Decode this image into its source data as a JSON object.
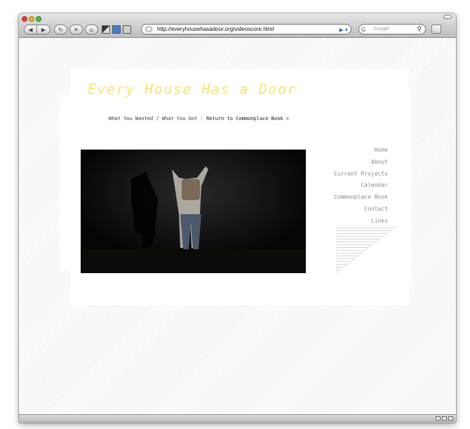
{
  "browser": {
    "url": "http://everyhousehasadoor.org/videoscore.html",
    "search_placeholder": "Google",
    "search_engine_glyph": "G",
    "go_glyph": "▶ ▾"
  },
  "site": {
    "title": "Every House Has a Door",
    "title_color": "#f6e46f",
    "subnav": {
      "current": "What You Wanted / What You Got",
      "separator": "|",
      "return_link": "Return to Commonplace Book >"
    },
    "nav": [
      "Home",
      "About",
      "Current Projects",
      "Calendar",
      "Commonplace Book",
      "Contact",
      "Links"
    ]
  },
  "icons": {
    "back": "back-arrow-icon",
    "forward": "forward-arrow-icon",
    "reload": "reload-icon",
    "stop": "stop-icon",
    "home": "home-icon",
    "search": "magnifier-icon"
  }
}
